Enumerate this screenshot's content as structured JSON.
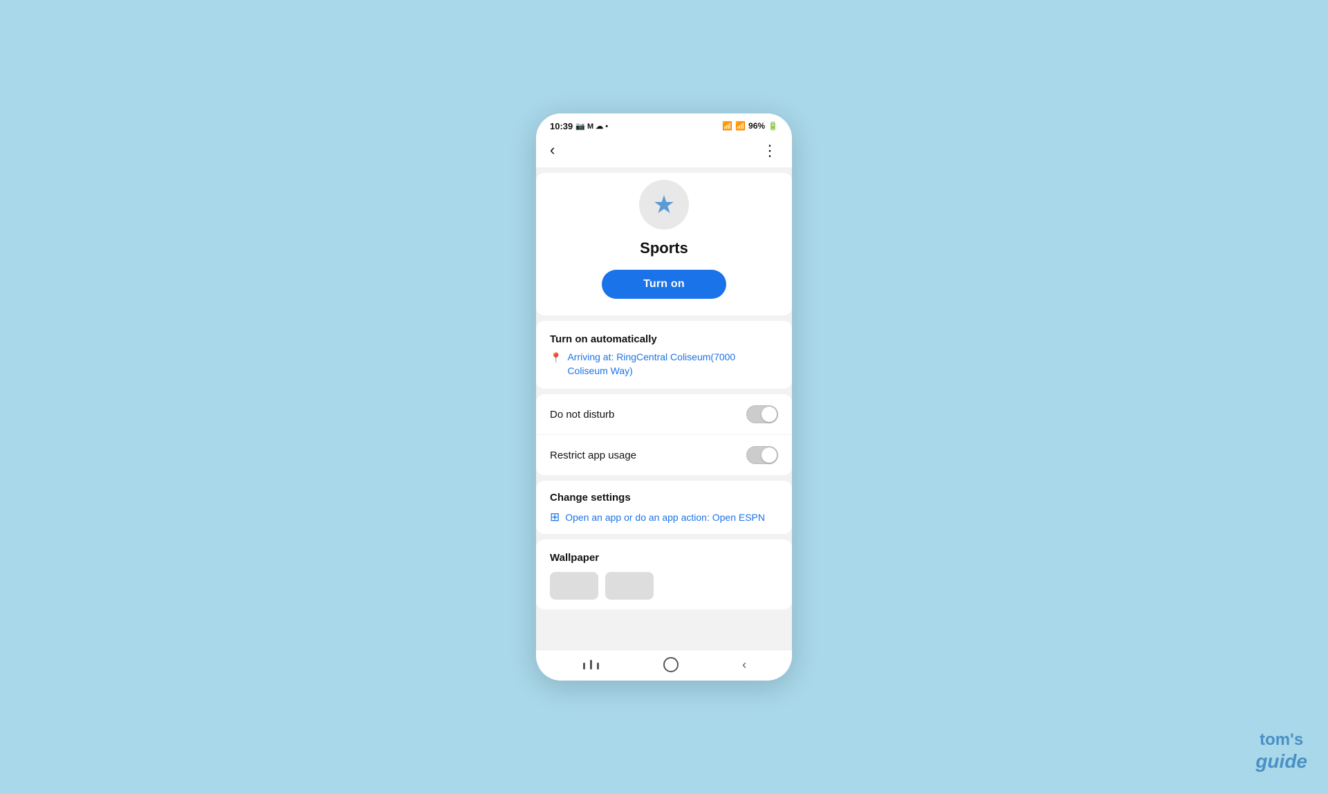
{
  "statusBar": {
    "time": "10:39",
    "icons": "📷 M ☁ •",
    "batteryLevel": "96%"
  },
  "topBar": {
    "backLabel": "‹",
    "menuLabel": "⋮"
  },
  "hero": {
    "modeName": "Sports",
    "turnOnLabel": "Turn on"
  },
  "turnOnAutomatically": {
    "title": "Turn on automatically",
    "locationText": "Arriving at: RingCentral Coliseum(7000 Coliseum Way)"
  },
  "toggles": [
    {
      "label": "Do not disturb",
      "enabled": false
    },
    {
      "label": "Restrict app usage",
      "enabled": false
    }
  ],
  "changeSettings": {
    "title": "Change settings",
    "actionLabel": "Open an app or do an app action: Open ESPN"
  },
  "wallpaper": {
    "title": "Wallpaper"
  },
  "bottomNav": {
    "recentLabel": "|||",
    "homeLabel": "○",
    "backLabel": "‹"
  },
  "watermark": {
    "line1": "tom's",
    "line2": "guide"
  }
}
